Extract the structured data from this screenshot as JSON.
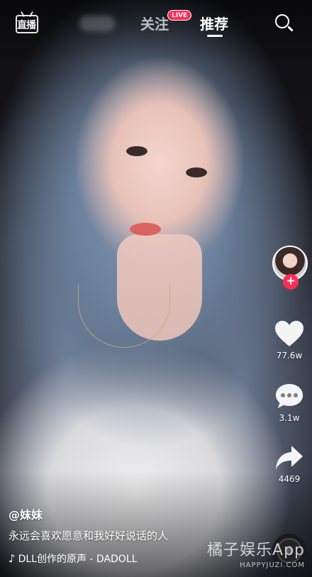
{
  "topbar": {
    "live_entry_label": "直播",
    "tabs": [
      {
        "label": "关注",
        "badge": "LIVE",
        "active": false
      },
      {
        "label": "推荐",
        "active": true
      }
    ],
    "search_icon": "search-icon"
  },
  "sidebar": {
    "follow_icon": "plus-icon",
    "like_count": "77.6w",
    "comment_count": "3.1w",
    "share_count": "4469"
  },
  "video_info": {
    "author": "@妹妹",
    "caption": "永远会喜欢愿意和我好好说话的人",
    "music": "DLL创作的原声 - DADOLL",
    "music_icon": "music-note-icon"
  },
  "watermark": {
    "main": "橘子娱乐App",
    "sub": "HAPPYJUZI.COM"
  },
  "colors": {
    "accent": "#fe2c55",
    "text": "#ffffff"
  }
}
